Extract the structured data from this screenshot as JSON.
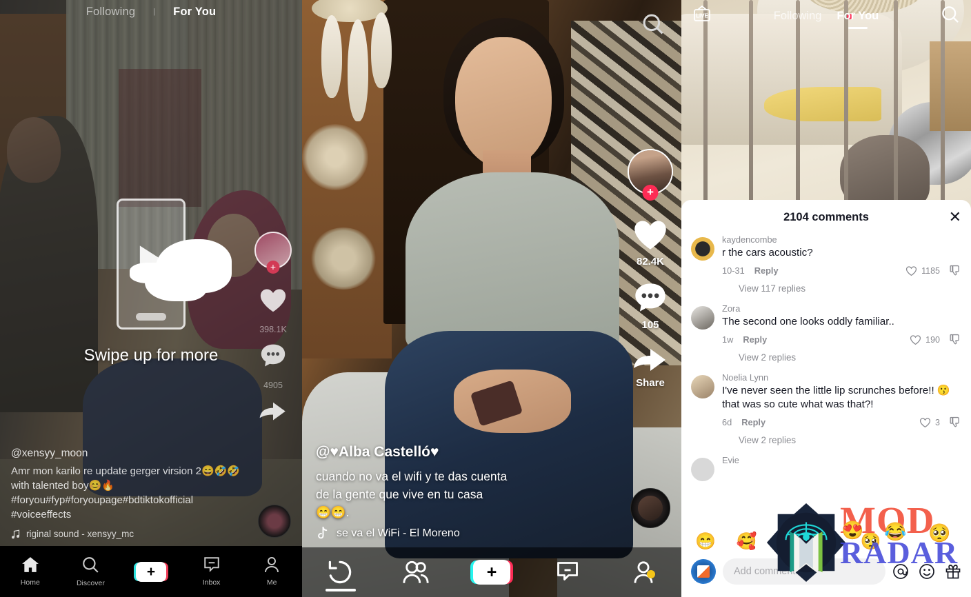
{
  "panel_left": {
    "top_tabs": [
      {
        "label": "Following",
        "active": false
      },
      {
        "label": "For You",
        "active": true
      }
    ],
    "separator": "|",
    "swipe_hint": "Swipe up for more",
    "caption": {
      "username": "@xensyy_moon",
      "description": "Amr mon karilo re update gerger virsion 2😄🤣🤣with talented boy😊🔥 #foryou#fyp#foryoupage#bdtiktokofficial #voiceeffects",
      "music_icon": "music-note-icon",
      "music": "riginal sound - xensyy_mc"
    },
    "actions": {
      "avatar_plus": "+",
      "like_icon": "heart-icon",
      "like_count": "398.1K",
      "comment_icon": "comment-icon",
      "comment_count": "4905",
      "share_icon": "share-arrow-icon"
    },
    "bottom_nav": [
      {
        "label": "Home",
        "icon": "home-icon",
        "active": true
      },
      {
        "label": "Discover",
        "icon": "search-icon",
        "active": false
      },
      {
        "label": "",
        "icon": "add-icon",
        "active": false
      },
      {
        "label": "Inbox",
        "icon": "inbox-icon",
        "active": false
      },
      {
        "label": "Me",
        "icon": "profile-icon",
        "active": false
      }
    ]
  },
  "panel_middle": {
    "search_icon": "search-icon",
    "caption": {
      "username": "@♥Alba Castelló♥",
      "line1": "cuando no va el wifi y te das cuenta",
      "line2": "de la gente que vive en tu casa",
      "line3": "😁😁.",
      "music_icon": "tiktok-note-icon",
      "music": "se va el WiFi - El Moreno"
    },
    "actions": {
      "avatar_plus": "+",
      "like_icon": "heart-icon",
      "like_count": "82.4K",
      "comment_icon": "comment-icon",
      "comment_count": "105",
      "share_icon": "share-arrow-icon",
      "share_label": "Share"
    },
    "bottom_nav": [
      {
        "icon": "refresh-back-icon",
        "label": ""
      },
      {
        "icon": "friends-icon",
        "label": ""
      },
      {
        "icon": "add-icon",
        "label": ""
      },
      {
        "icon": "inbox-icon",
        "label": ""
      },
      {
        "icon": "profile-icon",
        "label": ""
      }
    ]
  },
  "panel_right": {
    "live_icon": "live-tv-icon",
    "search_icon": "search-icon",
    "top_tabs": [
      {
        "label": "Following",
        "active": false
      },
      {
        "label": "For You",
        "active": true
      }
    ],
    "comments_sheet": {
      "title": "2104 comments",
      "close_icon": "close-x-icon",
      "comments": [
        {
          "avatar": "pug-avatar",
          "username": "kaydencombe",
          "text": "r the cars acoustic?",
          "time": "10-31",
          "reply_label": "Reply",
          "like_icon": "heart-outline-icon",
          "likes": "1185",
          "dislike_icon": "thumbs-down-icon",
          "view_replies": "View 117 replies"
        },
        {
          "avatar": "cat-avatar",
          "username": "Zora",
          "text": "The second one looks oddly familiar..",
          "time": "1w",
          "reply_label": "Reply",
          "like_icon": "heart-outline-icon",
          "likes": "190",
          "dislike_icon": "thumbs-down-icon",
          "view_replies": "View 2 replies"
        },
        {
          "avatar": "girl-avatar",
          "username": "Noelia Lynn",
          "text": "I've never seen the little lip scrunches before!! 😗 that was so cute what was that?!",
          "time": "6d",
          "reply_label": "Reply",
          "like_icon": "heart-outline-icon",
          "likes": "3",
          "dislike_icon": "thumbs-down-icon",
          "view_replies": "View 2 replies"
        },
        {
          "avatar": "blank-avatar",
          "username": "Evie",
          "text": "",
          "time": "",
          "reply_label": "",
          "like_icon": "heart-outline-icon",
          "likes": "",
          "dislike_icon": "thumbs-down-icon",
          "view_replies": ""
        }
      ],
      "emoji_bar": [
        "😁",
        "🥰",
        "😍",
        "😂",
        "🥺"
      ],
      "input": {
        "placeholder": "Add comment...",
        "mention_icon": "at-mention-icon",
        "emoji_icon": "emoji-smiley-icon",
        "gift_icon": "gift-icon"
      }
    }
  },
  "watermark": {
    "line1": "MOD",
    "line2": "RADAR",
    "line1_color": "#f2462f",
    "line2_color": "#3f44d8",
    "logo_icon": "mod-radar-logo-icon"
  }
}
